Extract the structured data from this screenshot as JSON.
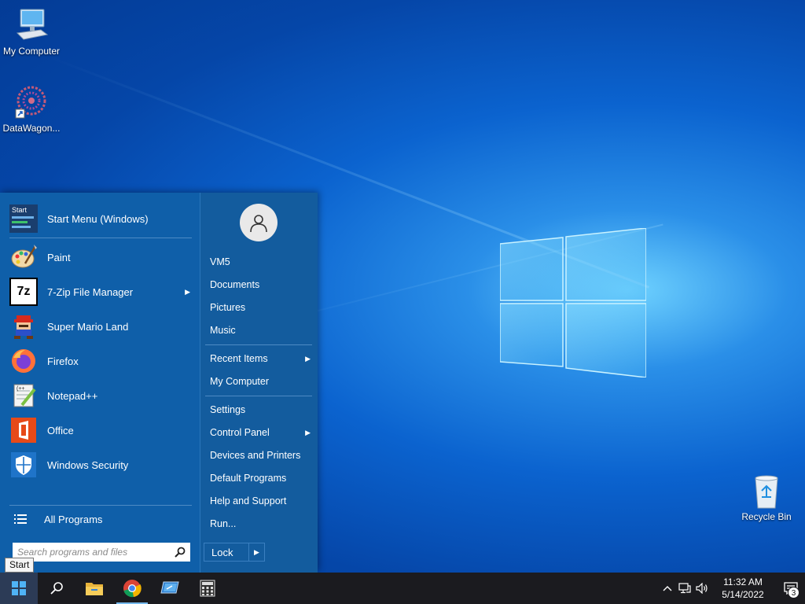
{
  "desktop": {
    "icons": [
      {
        "label": "My Computer",
        "icon": "computer-icon"
      },
      {
        "label": "DataWagon...",
        "icon": "datawagon-icon"
      },
      {
        "label": "Recycle Bin",
        "icon": "recycle-bin-icon"
      }
    ]
  },
  "start_menu": {
    "pinned": [
      {
        "label": "Start Menu (Windows)",
        "icon": "start-menu-icon"
      },
      {
        "label": "Paint",
        "icon": "paint-icon"
      },
      {
        "label": "7-Zip File Manager",
        "icon": "7zip-icon",
        "has_submenu": true
      },
      {
        "label": "Super Mario Land",
        "icon": "mario-icon"
      },
      {
        "label": "Firefox",
        "icon": "firefox-icon"
      },
      {
        "label": "Notepad++",
        "icon": "notepadpp-icon"
      },
      {
        "label": "Office",
        "icon": "office-icon"
      },
      {
        "label": "Windows Security",
        "icon": "shield-icon"
      }
    ],
    "start_icon_text": "Start",
    "all_programs_label": "All Programs",
    "search_placeholder": "Search programs and files",
    "right_items": [
      {
        "label": "VM5"
      },
      {
        "label": "Documents"
      },
      {
        "label": "Pictures"
      },
      {
        "label": "Music"
      },
      {
        "label": "Recent Items",
        "has_submenu": true
      },
      {
        "label": "My Computer"
      },
      {
        "label": "Settings"
      },
      {
        "label": "Control Panel",
        "has_submenu": true
      },
      {
        "label": "Devices and Printers"
      },
      {
        "label": "Default Programs"
      },
      {
        "label": "Help and Support"
      },
      {
        "label": "Run..."
      }
    ],
    "lock_label": "Lock"
  },
  "tooltip": "Start",
  "taskbar": {
    "apps": [
      "search-icon",
      "file-explorer-icon",
      "chrome-icon",
      "remote-desktop-icon",
      "calculator-icon"
    ],
    "clock_time": "11:32 AM",
    "clock_date": "5/14/2022",
    "notification_count": "3"
  },
  "colors": {
    "menu_bg": "#0f5fa9",
    "taskbar_bg": "#1b1b1f",
    "accent": "#76b9ed"
  }
}
